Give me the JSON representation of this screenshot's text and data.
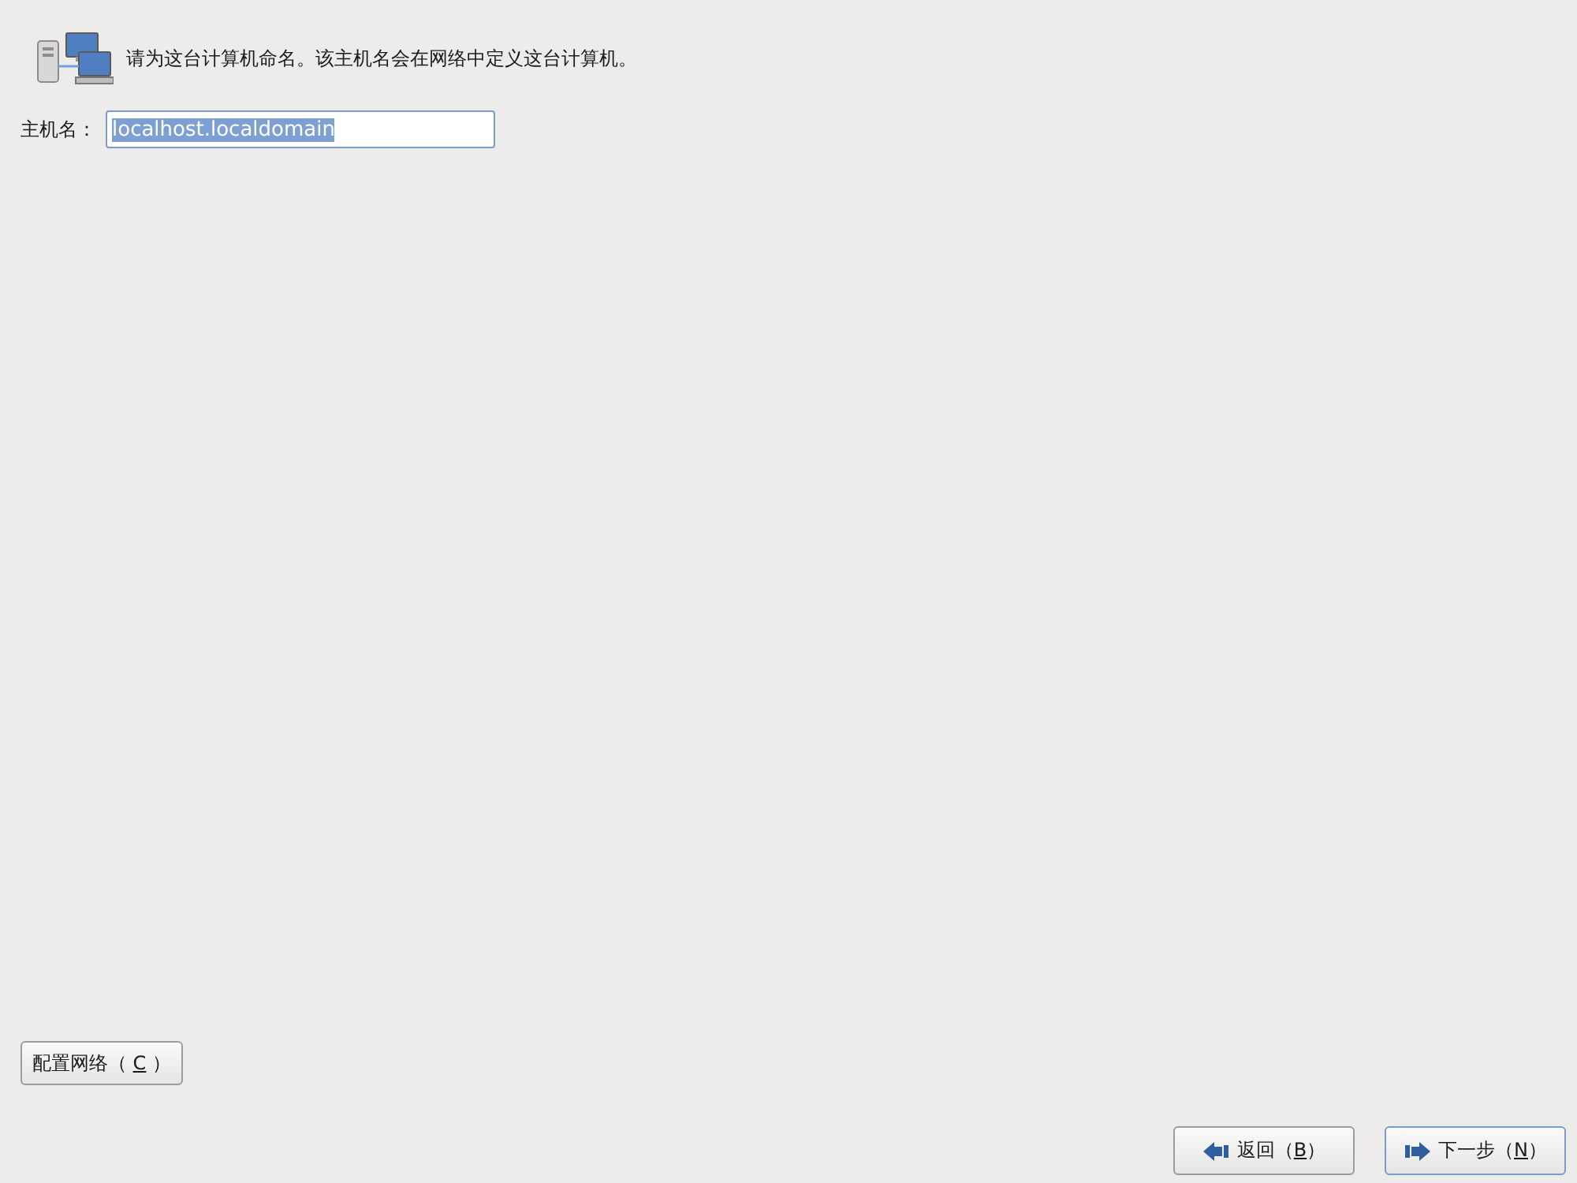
{
  "header": {
    "text": "请为这台计算机命名。该主机名会在网络中定义这台计算机。"
  },
  "hostname": {
    "label": "主机名：",
    "value": "localhost.localdomain",
    "text_selected": true
  },
  "configure_button": {
    "before": "配置网络（",
    "mnemonic": "C",
    "after": "）",
    "focused": false
  },
  "nav_buttons": [
    {
      "kind": "back",
      "before": "返回（",
      "mnemonic": "B",
      "after": "）",
      "focused": false
    },
    {
      "kind": "next",
      "before": "下一步（",
      "mnemonic": "N",
      "after": "）",
      "focused": true
    }
  ]
}
